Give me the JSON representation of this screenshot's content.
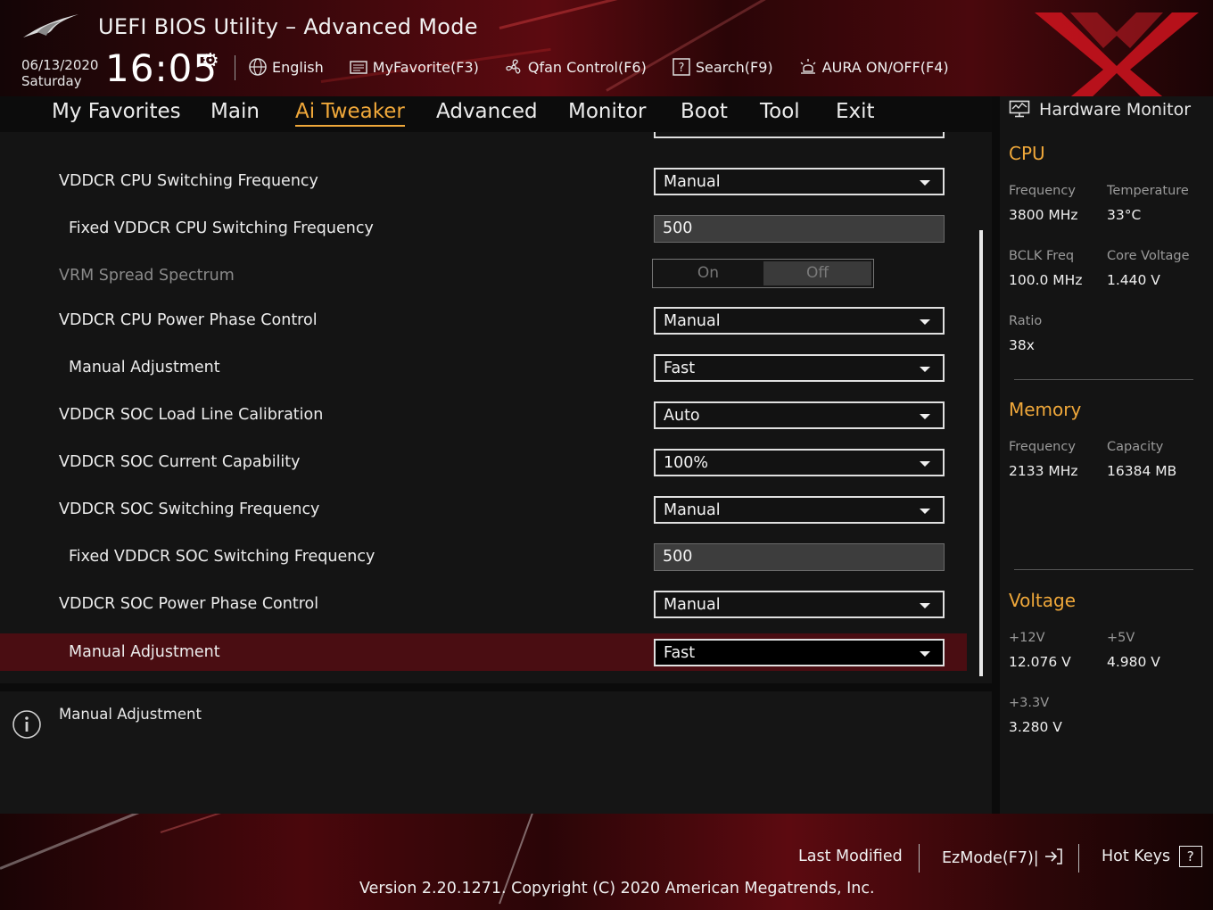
{
  "header": {
    "title": "UEFI BIOS Utility – Advanced Mode",
    "date": "06/13/2020",
    "day": "Saturday",
    "time": "16:05",
    "toolbar": [
      {
        "label": "English",
        "icon": "globe-icon"
      },
      {
        "label": "MyFavorite(F3)",
        "icon": "favorite-icon"
      },
      {
        "label": "Qfan Control(F6)",
        "icon": "fan-icon"
      },
      {
        "label": "Search(F9)",
        "icon": "search-help-icon"
      },
      {
        "label": "AURA ON/OFF(F4)",
        "icon": "aura-icon"
      }
    ]
  },
  "nav": {
    "tabs": [
      "My Favorites",
      "Main",
      "Ai Tweaker",
      "Advanced",
      "Monitor",
      "Boot",
      "Tool",
      "Exit"
    ],
    "active": "Ai Tweaker"
  },
  "settings": [
    {
      "label": "VDDCR CPU Switching Frequency",
      "value": "Manual",
      "type": "dropdown"
    },
    {
      "label": "Fixed VDDCR CPU Switching Frequency",
      "value": "500",
      "type": "input"
    },
    {
      "label": "VRM Spread Spectrum",
      "on_label": "On",
      "off_label": "Off",
      "type": "toggle"
    },
    {
      "label": "VDDCR CPU Power Phase Control",
      "value": "Manual",
      "type": "dropdown"
    },
    {
      "label": "Manual Adjustment",
      "value": "Fast",
      "type": "dropdown"
    },
    {
      "label": "VDDCR SOC Load Line Calibration",
      "value": "Auto",
      "type": "dropdown"
    },
    {
      "label": "VDDCR SOC Current Capability",
      "value": "100%",
      "type": "dropdown"
    },
    {
      "label": "VDDCR SOC Switching Frequency",
      "value": "Manual",
      "type": "dropdown"
    },
    {
      "label": "Fixed VDDCR SOC Switching Frequency",
      "value": "500",
      "type": "input"
    },
    {
      "label": "VDDCR SOC Power Phase Control",
      "value": "Manual",
      "type": "dropdown"
    },
    {
      "label": "Manual Adjustment",
      "value": "Fast",
      "type": "dropdown"
    }
  ],
  "info": {
    "text": "Manual Adjustment"
  },
  "hardware_monitor": {
    "title": "Hardware Monitor",
    "cpu": {
      "heading": "CPU",
      "frequency_label": "Frequency",
      "frequency": "3800 MHz",
      "temperature_label": "Temperature",
      "temperature": "33°C",
      "bclk_label": "BCLK Freq",
      "bclk": "100.0 MHz",
      "core_voltage_label": "Core Voltage",
      "core_voltage": "1.440 V",
      "ratio_label": "Ratio",
      "ratio": "38x"
    },
    "memory": {
      "heading": "Memory",
      "frequency_label": "Frequency",
      "frequency": "2133 MHz",
      "capacity_label": "Capacity",
      "capacity": "16384 MB"
    },
    "voltage": {
      "heading": "Voltage",
      "v12_label": "+12V",
      "v12": "12.076 V",
      "v5_label": "+5V",
      "v5": "4.980 V",
      "v33_label": "+3.3V",
      "v33": "3.280 V"
    }
  },
  "footer": {
    "last_modified": "Last Modified",
    "ezmode": "EzMode(F7)|",
    "hotkeys": "Hot Keys",
    "hotkeys_key": "?",
    "version": "Version 2.20.1271. Copyright (C) 2020 American Megatrends, Inc."
  },
  "colors": {
    "accent": "#f0a83a",
    "selected_row": "#4a0d12",
    "brand_red": "#c8141e"
  }
}
